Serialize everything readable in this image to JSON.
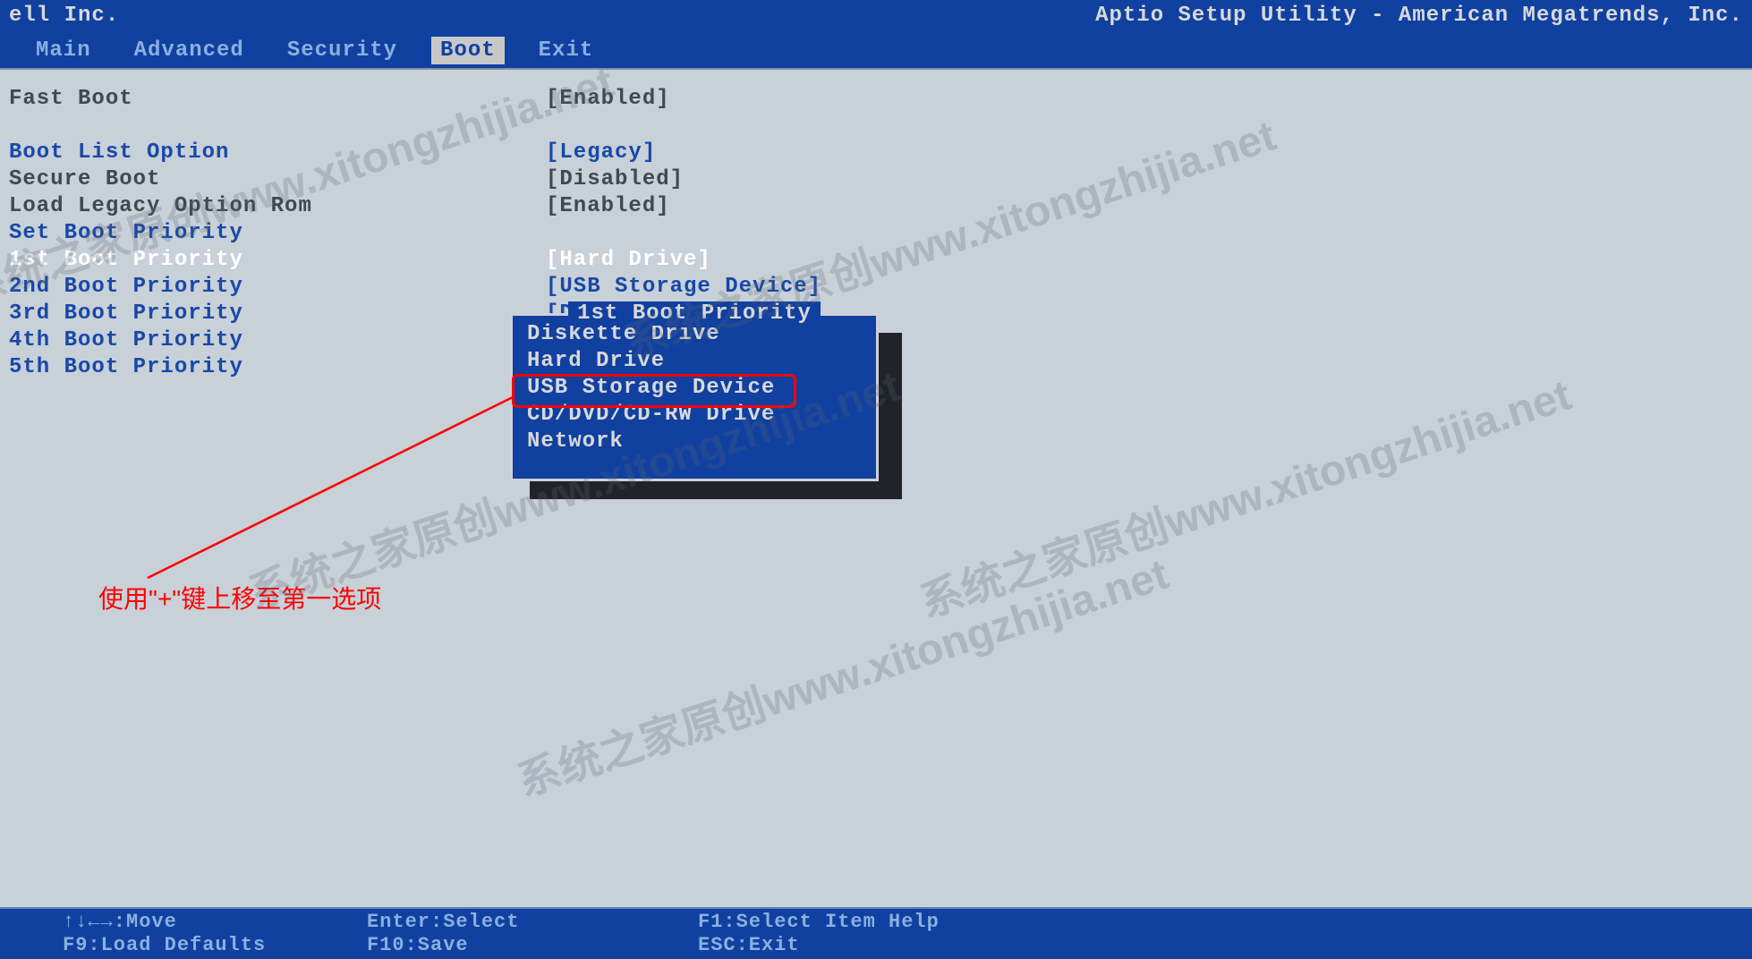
{
  "header": {
    "vendor": "ell Inc.",
    "utility": "Aptio Setup Utility - American Megatrends, Inc."
  },
  "menu": {
    "items": [
      "Main",
      "Advanced",
      "Security",
      "Boot",
      "Exit"
    ],
    "active_index": 3
  },
  "settings": [
    {
      "label": "Fast Boot",
      "value": "[Enabled]",
      "type": "plain"
    },
    {
      "type": "blank"
    },
    {
      "label": "Boot List Option",
      "value": "[Legacy]",
      "type": "normal"
    },
    {
      "label": "Secure Boot",
      "value": "[Disabled]",
      "type": "plain"
    },
    {
      "label": "Load Legacy Option Rom",
      "value": "[Enabled]",
      "type": "plain"
    },
    {
      "label": "Set Boot Priority",
      "value": "",
      "type": "normal"
    },
    {
      "label": "1st Boot Priority",
      "value": "[Hard Drive]",
      "type": "selected"
    },
    {
      "label": "2nd Boot Priority",
      "value": "[USB Storage Device]",
      "type": "normal"
    },
    {
      "label": "3rd Boot Priority",
      "value": "[Diskette Drive]",
      "type": "normal"
    },
    {
      "label": "4th Boot Priority",
      "value": "",
      "type": "normal"
    },
    {
      "label": "5th Boot Priority",
      "value": "",
      "type": "normal"
    }
  ],
  "popup": {
    "title": "1st Boot Priority",
    "options": [
      "Diskette Drive",
      "Hard Drive",
      "USB Storage Device",
      "CD/DVD/CD-RW Drive",
      "Network"
    ],
    "highlighted_index": 2
  },
  "annotation": {
    "text": "使用\"+\"键上移至第一选项"
  },
  "footer": {
    "rows": [
      {
        "c1": "↑↓←→:Move",
        "c2": "Enter:Select",
        "c3": "F1:Select Item Help"
      },
      {
        "c1": "F9:Load Defaults",
        "c2": "F10:Save",
        "c3": "ESC:Exit"
      }
    ]
  },
  "watermarks": [
    "系统之家原创www.xitongzhijia.net",
    "系统之家原创www.xitongzhijia.net",
    "系统之家原创www.xitongzhijia.net",
    "系统之家原创www.xitongzhijia.net",
    "系统之家原创www.xitongzhijia.net"
  ]
}
